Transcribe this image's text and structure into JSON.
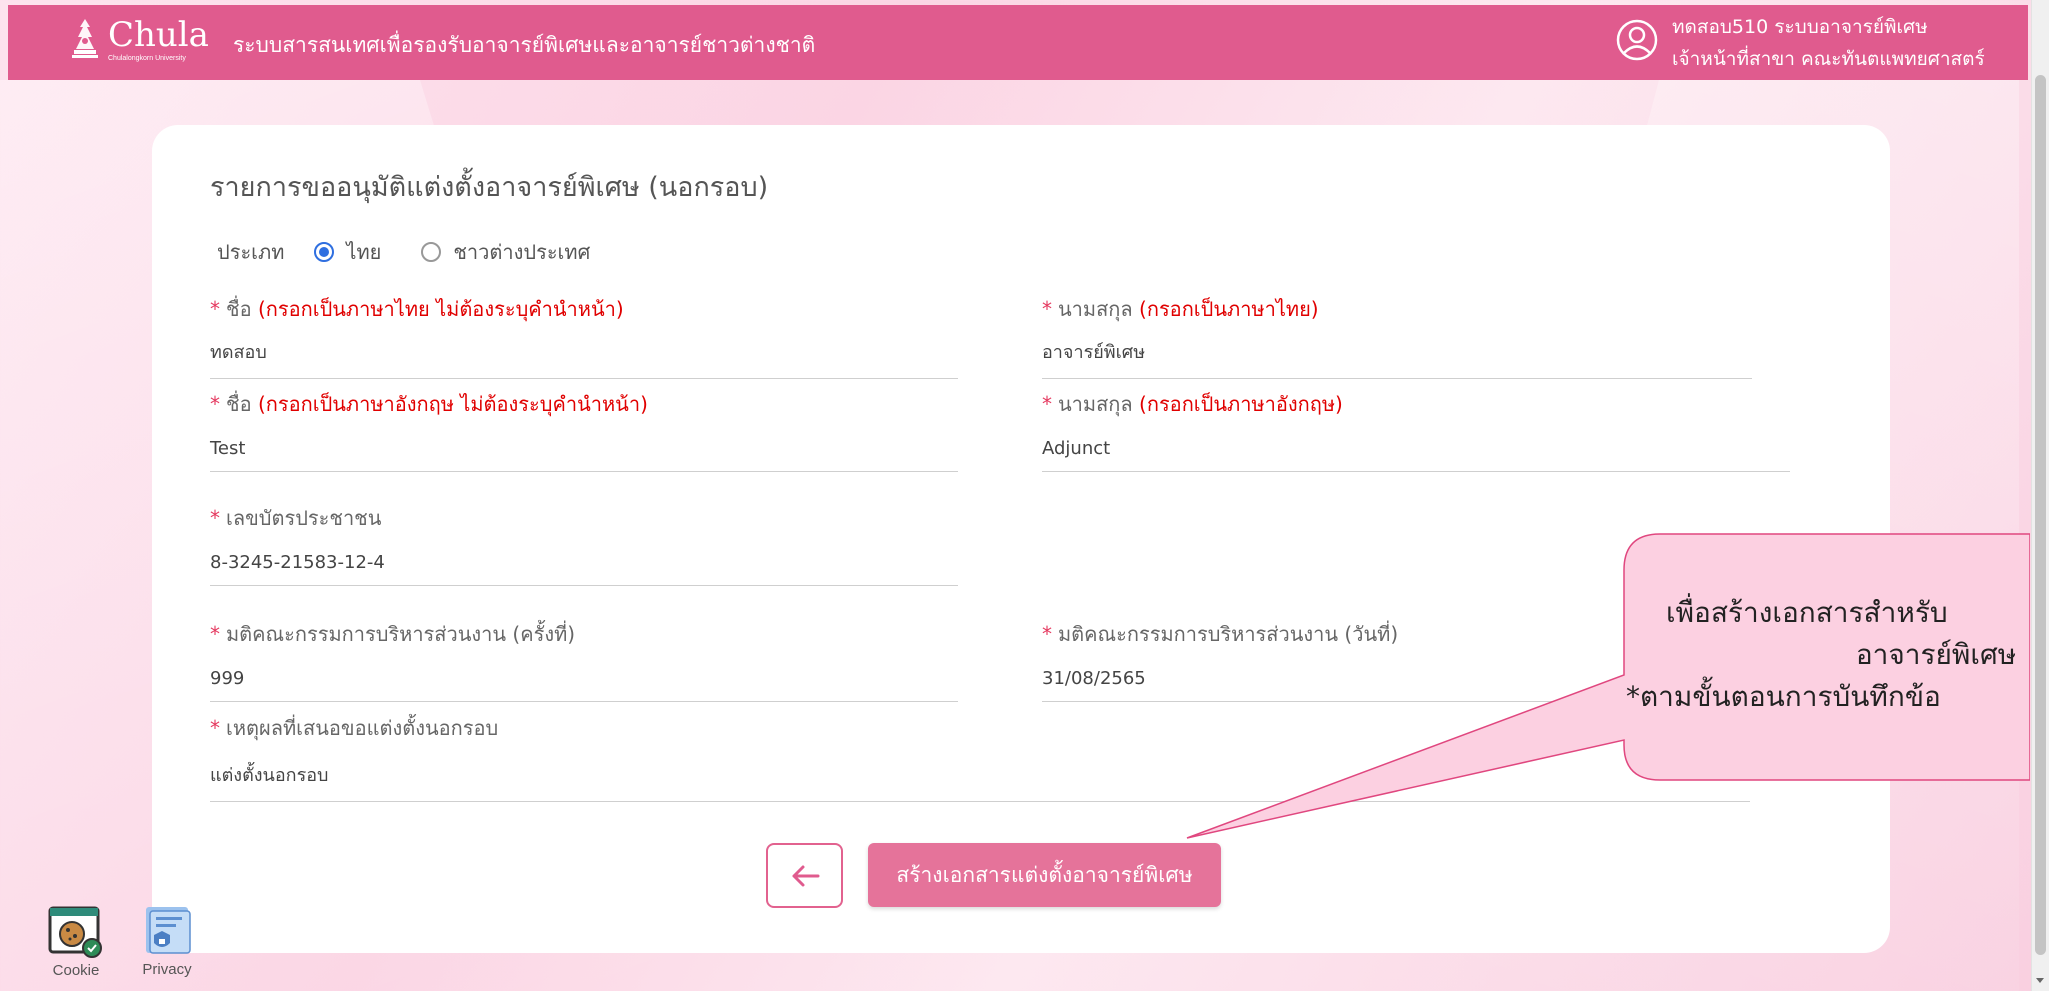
{
  "header": {
    "logo_text": "Chula",
    "logo_subtext": "Chulalongkorn University",
    "app_title": "ระบบสารสนเทศเพื่อรองรับอาจารย์พิเศษและอาจารย์ชาวต่างชาติ",
    "user_name": "ทดสอบ510 ระบบอาจารย์พิเศษ",
    "user_role": "เจ้าหน้าที่สาขา คณะทันตแพทยศาสตร์"
  },
  "form": {
    "title": "รายการขออนุมัติแต่งตั้งอาจารย์พิเศษ (นอกรอบ)",
    "type_label": "ประเภท",
    "type_options": [
      {
        "label": "ไทย",
        "checked": true
      },
      {
        "label": "ชาวต่างประเทศ",
        "checked": false
      }
    ],
    "fields": {
      "first_name_th": {
        "required": "*",
        "label": "ชื่อ",
        "hint": "(กรอกเป็นภาษาไทย ไม่ต้องระบุคำนำหน้า)",
        "value": "ทดสอบ"
      },
      "last_name_th": {
        "required": "*",
        "label": "นามสกุล",
        "hint": "(กรอกเป็นภาษาไทย)",
        "value": "อาจารย์พิเศษ"
      },
      "first_name_en": {
        "required": "*",
        "label": "ชื่อ",
        "hint": "(กรอกเป็นภาษาอังกฤษ ไม่ต้องระบุคำนำหน้า)",
        "value": "Test"
      },
      "last_name_en": {
        "required": "*",
        "label": "นามสกุล",
        "hint": "(กรอกเป็นภาษาอังกฤษ)",
        "value": "Adjunct"
      },
      "id_card": {
        "required": "*",
        "label": "เลขบัตรประชาชน",
        "value": "8-3245-21583-12-4"
      },
      "committee_no": {
        "required": "*",
        "label": "มติคณะกรรมการบริหารส่วนงาน (ครั้งที่)",
        "value": "999"
      },
      "committee_date": {
        "required": "*",
        "label": "มติคณะกรรมการบริหารส่วนงาน (วันที่)",
        "value": "31/08/2565"
      },
      "reason": {
        "required": "*",
        "label": "เหตุผลที่เสนอขอแต่งตั้งนอกรอบ",
        "value": "แต่งตั้งนอกรอบ"
      }
    }
  },
  "buttons": {
    "back_icon": "arrow-left-icon",
    "create_label": "สร้างเอกสารแต่งตั้งอาจารย์พิเศษ"
  },
  "callout": {
    "line1": "เพื่อสร้างเอกสารสำหรับ",
    "line2": "อาจารย์พิเศษ",
    "line3": "*ตามขั้นตอนการบันทึกข้อ"
  },
  "footer": {
    "cookie_label": "Cookie",
    "privacy_label": "Privacy"
  },
  "colors": {
    "header": "#e05b8e",
    "accent": "#e5739a",
    "required": "#e5395f",
    "hint": "#e00000",
    "radio": "#2f6fe0"
  }
}
